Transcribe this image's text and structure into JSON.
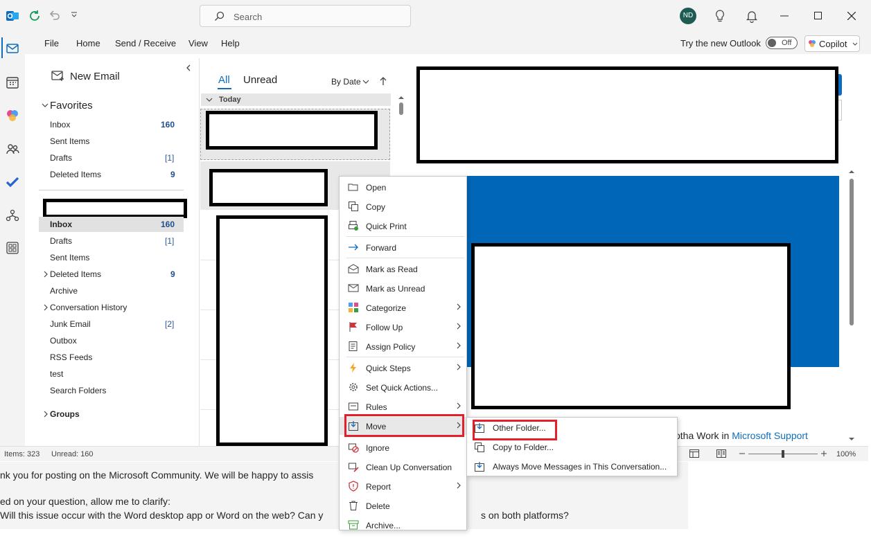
{
  "titlebar": {
    "search_placeholder": "Search",
    "avatar_initials": "ND"
  },
  "menubar": {
    "items": [
      "File",
      "Home",
      "Send / Receive",
      "View",
      "Help"
    ],
    "try_new_outlook": "Try the new Outlook",
    "toggle_label": "Off",
    "copilot_label": "Copilot"
  },
  "folders": {
    "new_email": "New Email",
    "favorites_header": "Favorites",
    "favorites": [
      {
        "name": "Inbox",
        "count": "160"
      },
      {
        "name": "Sent Items",
        "count": ""
      },
      {
        "name": "Drafts",
        "count": "[1]"
      },
      {
        "name": "Deleted Items",
        "count": "9"
      }
    ],
    "account_items": [
      {
        "name": "Inbox",
        "count": "160"
      },
      {
        "name": "Drafts",
        "count": "[1]"
      },
      {
        "name": "Sent Items",
        "count": ""
      },
      {
        "name": "Deleted Items",
        "count": "9"
      },
      {
        "name": "Archive",
        "count": ""
      },
      {
        "name": "Conversation History",
        "count": ""
      },
      {
        "name": "Junk Email",
        "count": "[2]"
      },
      {
        "name": "Outbox",
        "count": ""
      },
      {
        "name": "RSS Feeds",
        "count": ""
      },
      {
        "name": "test",
        "count": ""
      },
      {
        "name": "Search Folders",
        "count": ""
      }
    ],
    "groups_header": "Groups"
  },
  "message_list": {
    "tab_all": "All",
    "tab_unread": "Unread",
    "sort_label": "By Date",
    "group_today": "Today"
  },
  "reading_pane": {
    "footer_text": "otha Work in ",
    "footer_link": "Microsoft Support"
  },
  "statusbar": {
    "items": "Items: 323",
    "unread": "Unread: 160",
    "zoom": "100%"
  },
  "context_menu": {
    "items": [
      {
        "label": "Open",
        "icon": "open-icon"
      },
      {
        "label": "Copy",
        "icon": "copy-icon"
      },
      {
        "label": "Quick Print",
        "icon": "print-icon"
      },
      {
        "label": "Forward",
        "icon": "forward-icon"
      },
      {
        "label": "Mark as Read",
        "icon": "mail-open-icon"
      },
      {
        "label": "Mark as Unread",
        "icon": "mail-icon"
      },
      {
        "label": "Categorize",
        "icon": "categorize-icon"
      },
      {
        "label": "Follow Up",
        "icon": "flag-icon"
      },
      {
        "label": "Assign Policy",
        "icon": "policy-icon"
      },
      {
        "label": "Quick Steps",
        "icon": "lightning-icon"
      },
      {
        "label": "Set Quick Actions...",
        "icon": "gear-icon"
      },
      {
        "label": "Rules",
        "icon": "rules-icon"
      },
      {
        "label": "Move",
        "icon": "move-icon"
      },
      {
        "label": "Ignore",
        "icon": "ignore-icon"
      },
      {
        "label": "Clean Up Conversation",
        "icon": "cleanup-icon"
      },
      {
        "label": "Report",
        "icon": "report-icon"
      },
      {
        "label": "Delete",
        "icon": "trash-icon"
      },
      {
        "label": "Archive...",
        "icon": "archive-icon"
      }
    ]
  },
  "submenu": {
    "items": [
      {
        "label": "Other Folder...",
        "icon": "move-folder-icon"
      },
      {
        "label": "Copy to Folder...",
        "icon": "copy-folder-icon"
      },
      {
        "label": "Always Move Messages in This Conversation...",
        "icon": "always-move-icon"
      }
    ]
  },
  "background_page": {
    "line1": "nk you for posting on the Microsoft Community. We will be happy to assis",
    "line2": "ed on your question, allow me to clarify:",
    "line3a": "Will this issue occur with the Word desktop app or Word on the web? Can y",
    "line3b": "s on both platforms?"
  },
  "colors": {
    "accent": "#0f6cbd",
    "highlight_red": "#e3202a",
    "banner_blue": "#0067b8"
  }
}
